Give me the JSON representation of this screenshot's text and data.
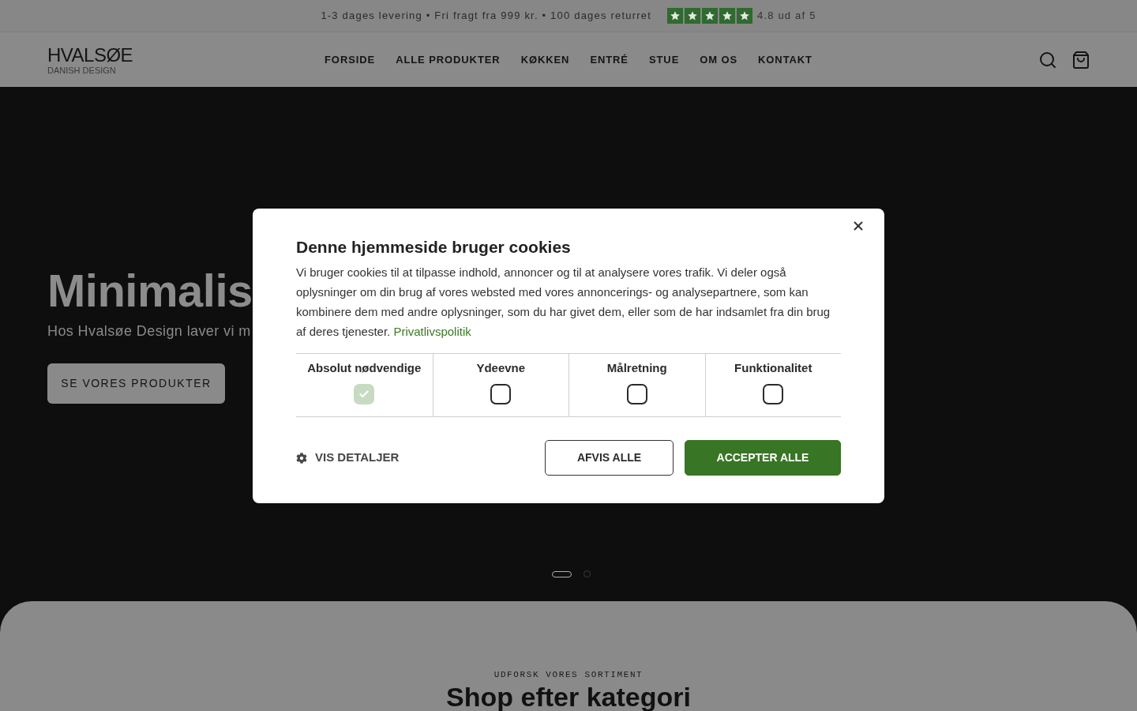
{
  "announcement_bar": {
    "text": "1-3 dages levering • Fri fragt fra 999 kr. • 100 dages returret",
    "rating": {
      "stars": 5,
      "text": "4.8 ud af 5"
    }
  },
  "header": {
    "logo": {
      "name": "HVALSØE",
      "tagline": "DANISH DESIGN"
    },
    "nav": [
      {
        "label": "FORSIDE"
      },
      {
        "label": "ALLE PRODUKTER"
      },
      {
        "label": "KØKKEN"
      },
      {
        "label": "ENTRÉ"
      },
      {
        "label": "STUE"
      },
      {
        "label": "OM OS"
      },
      {
        "label": "KONTAKT"
      }
    ]
  },
  "hero": {
    "title": "Minimalis",
    "subtitle": "Hos Hvalsøe Design laver vi m",
    "button": "SE VORES PRODUKTER",
    "slides": [
      {
        "selected": true
      },
      {
        "selected": false
      }
    ]
  },
  "category_section": {
    "eyebrow": "UDFORSK VORES SORTIMENT",
    "title": "Shop efter kategori"
  },
  "cookie_dialog": {
    "title": "Denne hjemmeside bruger cookies",
    "body": "Vi bruger cookies til at tilpasse indhold, annoncer og til at analysere vores trafik. Vi deler også oplysninger om din brug af vores websted med vores annoncerings- og analysepartnere, som kan kombinere dem med andre oplysninger, som du har givet dem, eller som de har indsamlet fra din brug af deres tjenester.",
    "link": "Privatlivspolitik",
    "categories": [
      {
        "label": "Absolut nødvendige",
        "checked": true,
        "disabled": true
      },
      {
        "label": "Ydeevne",
        "checked": false,
        "disabled": false
      },
      {
        "label": "Målretning",
        "checked": false,
        "disabled": false
      },
      {
        "label": "Funktionalitet",
        "checked": false,
        "disabled": false
      }
    ],
    "details_link": "VIS DETALJER",
    "buttons": [
      {
        "label": "AFVIS ALLE",
        "kind": "outline"
      },
      {
        "label": "ACCEPTER ALLE",
        "kind": "primary"
      }
    ]
  }
}
